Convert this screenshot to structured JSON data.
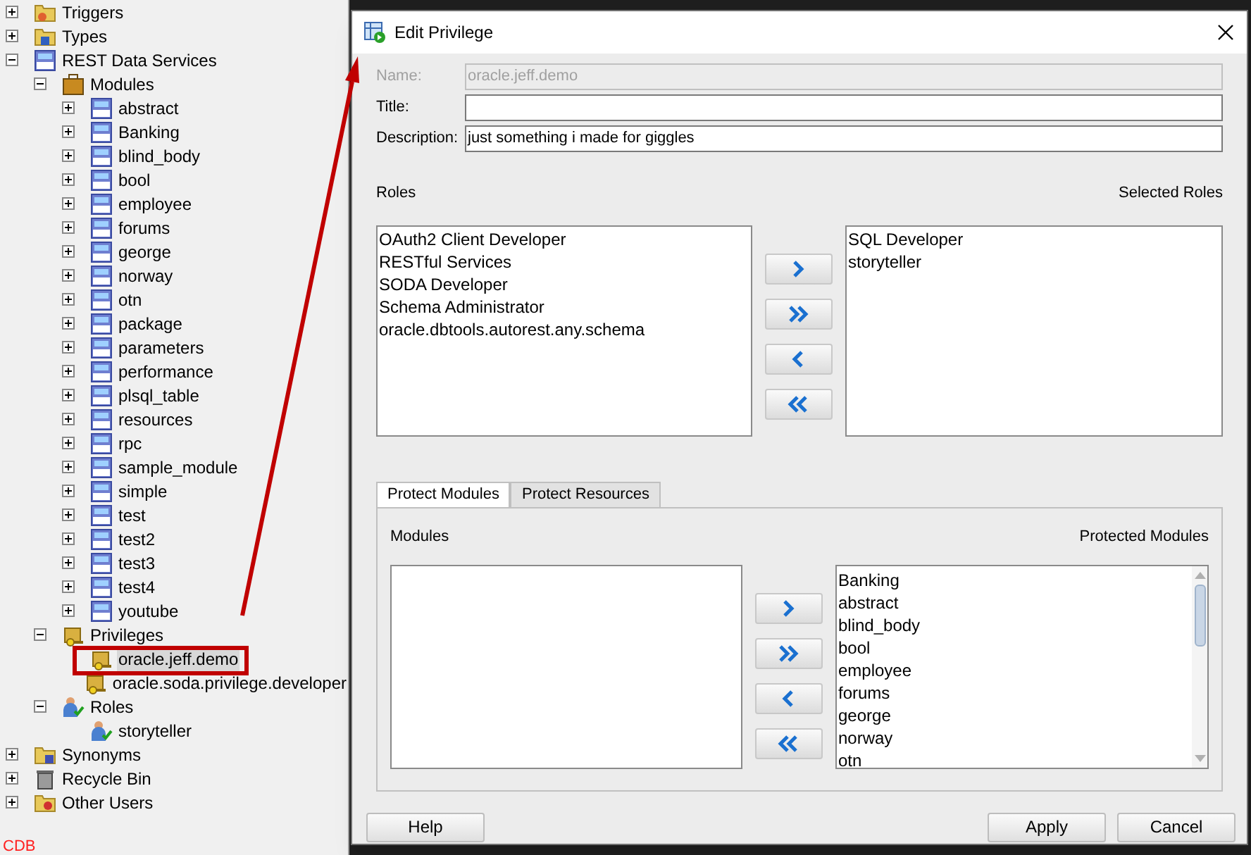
{
  "tree": [
    {
      "label": "Triggers",
      "kind": "triggers",
      "expanded": false
    },
    {
      "label": "Types",
      "kind": "types",
      "expanded": false
    },
    {
      "label": "REST Data Services",
      "kind": "rest",
      "expanded": true,
      "children": [
        {
          "label": "Modules",
          "kind": "modules",
          "expanded": true,
          "children": [
            {
              "label": "abstract",
              "kind": "module",
              "expanded": false
            },
            {
              "label": "Banking",
              "kind": "module",
              "expanded": false
            },
            {
              "label": "blind_body",
              "kind": "module",
              "expanded": false
            },
            {
              "label": "bool",
              "kind": "module",
              "expanded": false
            },
            {
              "label": "employee",
              "kind": "module",
              "expanded": false
            },
            {
              "label": "forums",
              "kind": "module",
              "expanded": false
            },
            {
              "label": "george",
              "kind": "module",
              "expanded": false
            },
            {
              "label": "norway",
              "kind": "module",
              "expanded": false
            },
            {
              "label": "otn",
              "kind": "module",
              "expanded": false
            },
            {
              "label": "package",
              "kind": "module",
              "expanded": false
            },
            {
              "label": "parameters",
              "kind": "module",
              "expanded": false
            },
            {
              "label": "performance",
              "kind": "module",
              "expanded": false
            },
            {
              "label": "plsql_table",
              "kind": "module",
              "expanded": false
            },
            {
              "label": "resources",
              "kind": "module",
              "expanded": false
            },
            {
              "label": "rpc",
              "kind": "module",
              "expanded": false
            },
            {
              "label": "sample_module",
              "kind": "module",
              "expanded": false
            },
            {
              "label": "simple",
              "kind": "module",
              "expanded": false
            },
            {
              "label": "test",
              "kind": "module",
              "expanded": false
            },
            {
              "label": "test2",
              "kind": "module",
              "expanded": false
            },
            {
              "label": "test3",
              "kind": "module",
              "expanded": false
            },
            {
              "label": "test4",
              "kind": "module",
              "expanded": false
            },
            {
              "label": "youtube",
              "kind": "module",
              "expanded": false
            }
          ]
        },
        {
          "label": "Privileges",
          "kind": "privileges",
          "expanded": true,
          "children": [
            {
              "label": "oracle.jeff.demo",
              "kind": "privilege",
              "selected": true
            },
            {
              "label": "oracle.soda.privilege.developer",
              "kind": "privilege",
              "selected": false
            }
          ]
        },
        {
          "label": "Roles",
          "kind": "roles",
          "expanded": true,
          "children": [
            {
              "label": "storyteller",
              "kind": "role"
            }
          ]
        }
      ]
    },
    {
      "label": "Synonyms",
      "kind": "synonyms",
      "expanded": false
    },
    {
      "label": "Recycle Bin",
      "kind": "recycle",
      "expanded": false
    },
    {
      "label": "Other Users",
      "kind": "users",
      "expanded": false
    }
  ],
  "connection": "CDB",
  "dialog": {
    "title": "Edit Privilege",
    "fields": [
      {
        "label": "Name:",
        "value": "oracle.jeff.demo",
        "disabled": true
      },
      {
        "label": "Title:",
        "disabled": false
      },
      {
        "label": "Description:",
        "value": "just something i made for giggles",
        "disabled": false
      }
    ],
    "roles_label": "Roles",
    "selected_roles_label": "Selected Roles",
    "roles": [
      "OAuth2 Client Developer",
      "RESTful Services",
      "SODA Developer",
      "Schema Administrator",
      "oracle.dbtools.autorest.any.schema"
    ],
    "selected_roles": [
      "SQL Developer",
      "storyteller"
    ],
    "tabs": [
      {
        "label": "Protect Modules",
        "selected": true
      },
      {
        "label": "Protect Resources",
        "selected": false
      }
    ],
    "modules_label": "Modules",
    "protected_modules_label": "Protected Modules",
    "protected_modules": [
      "Banking",
      "abstract",
      "blind_body",
      "bool",
      "employee",
      "forums",
      "george",
      "norway",
      "otn"
    ],
    "buttons": {
      "help": "Help",
      "apply": "Apply",
      "cancel": "Cancel"
    }
  }
}
